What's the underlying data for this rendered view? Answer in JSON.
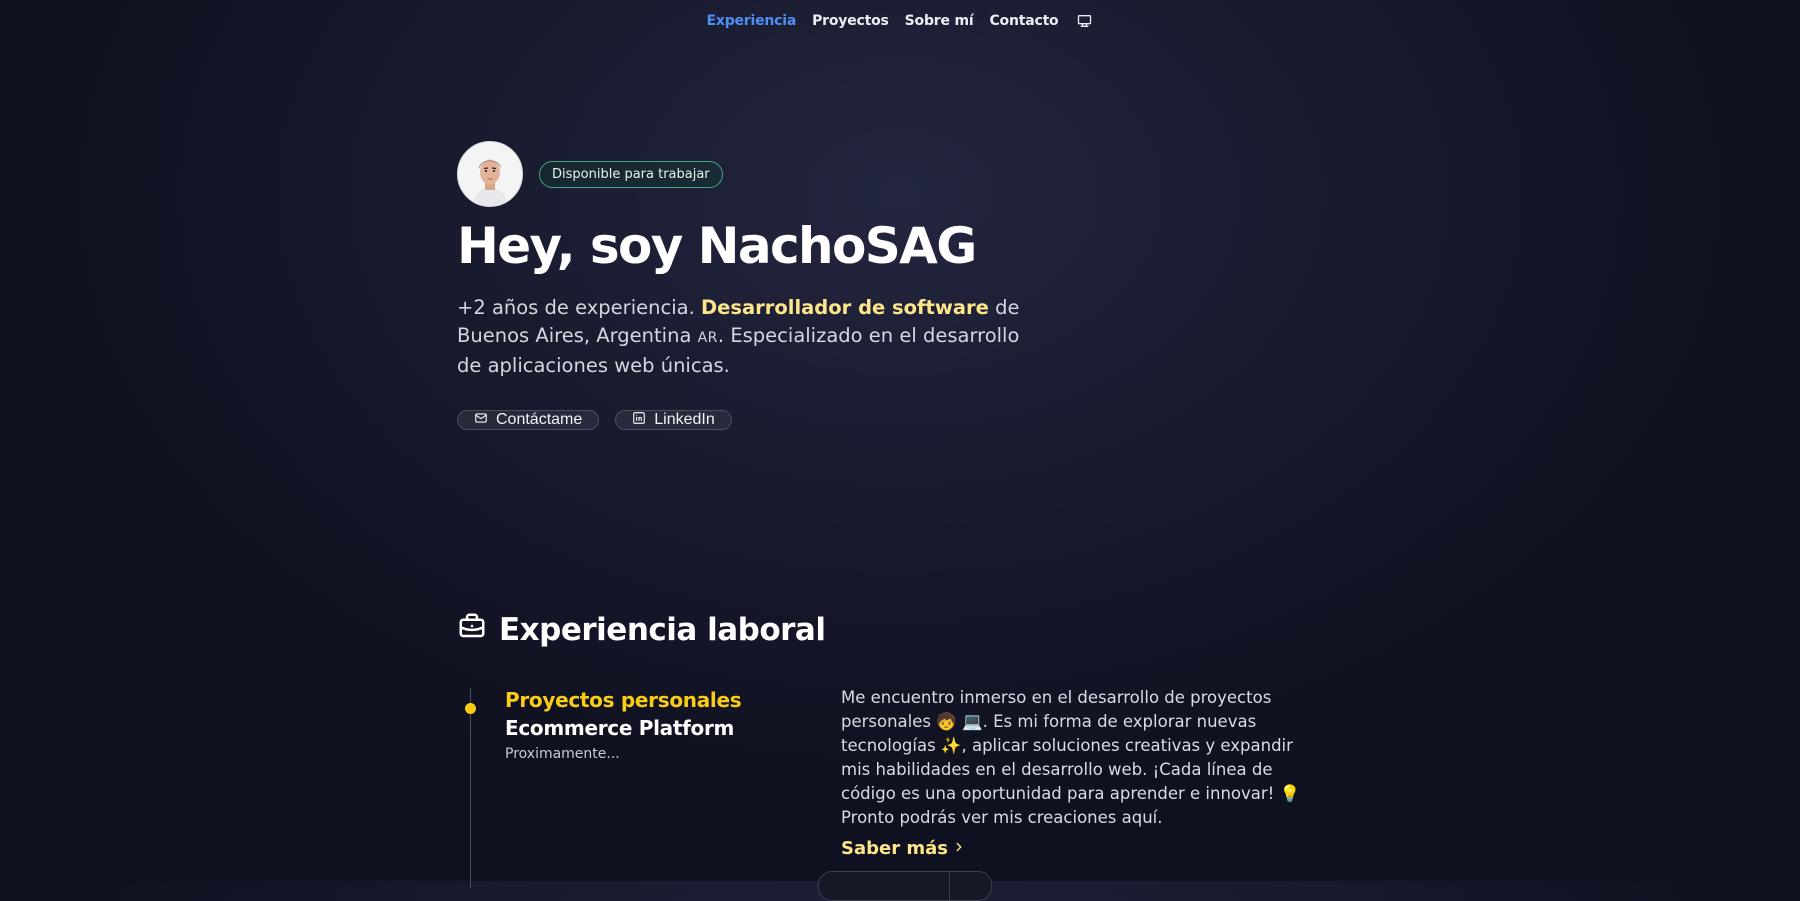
{
  "nav": {
    "items": [
      {
        "label": "Experiencia",
        "active": true
      },
      {
        "label": "Proyectos"
      },
      {
        "label": "Sobre mí"
      },
      {
        "label": "Contacto"
      }
    ],
    "theme_icon": "monitor-icon"
  },
  "hero": {
    "badge": "Disponible para trabajar",
    "title": "Hey, soy NachoSAG",
    "desc_part1": "+2 años de experiencia. ",
    "desc_highlight": "Desarrollador de software",
    "desc_part2": " de Buenos Aires, Argentina ",
    "desc_flag": "AR",
    "desc_part3": ". Especializado en el desarrollo de aplicaciones web únicas.",
    "buttons": {
      "contact": "Contáctame",
      "linkedin": "LinkedIn"
    }
  },
  "experience": {
    "heading": "Experiencia laboral",
    "items": [
      {
        "company": "Proyectos personales",
        "role": "Ecommerce Platform",
        "date": "Proximamente...",
        "description": "Me encuentro inmerso en el desarrollo de proyectos personales 🧒 💻. Es mi forma de explorar nuevas tecnologías ✨, aplicar soluciones creativas y expandir mis habilidades en el desarrollo web. ¡Cada línea de código es una oportunidad para aprender e innovar! 💡 Pronto podrás ver mis creaciones aquí.",
        "link": "Saber más"
      }
    ]
  },
  "colors": {
    "accent_blue": "#4f8ef5",
    "accent_yellow": "#facc15",
    "highlight_yellow": "#fde68a",
    "badge_green": "#3fa887",
    "background": "#191b2f"
  }
}
